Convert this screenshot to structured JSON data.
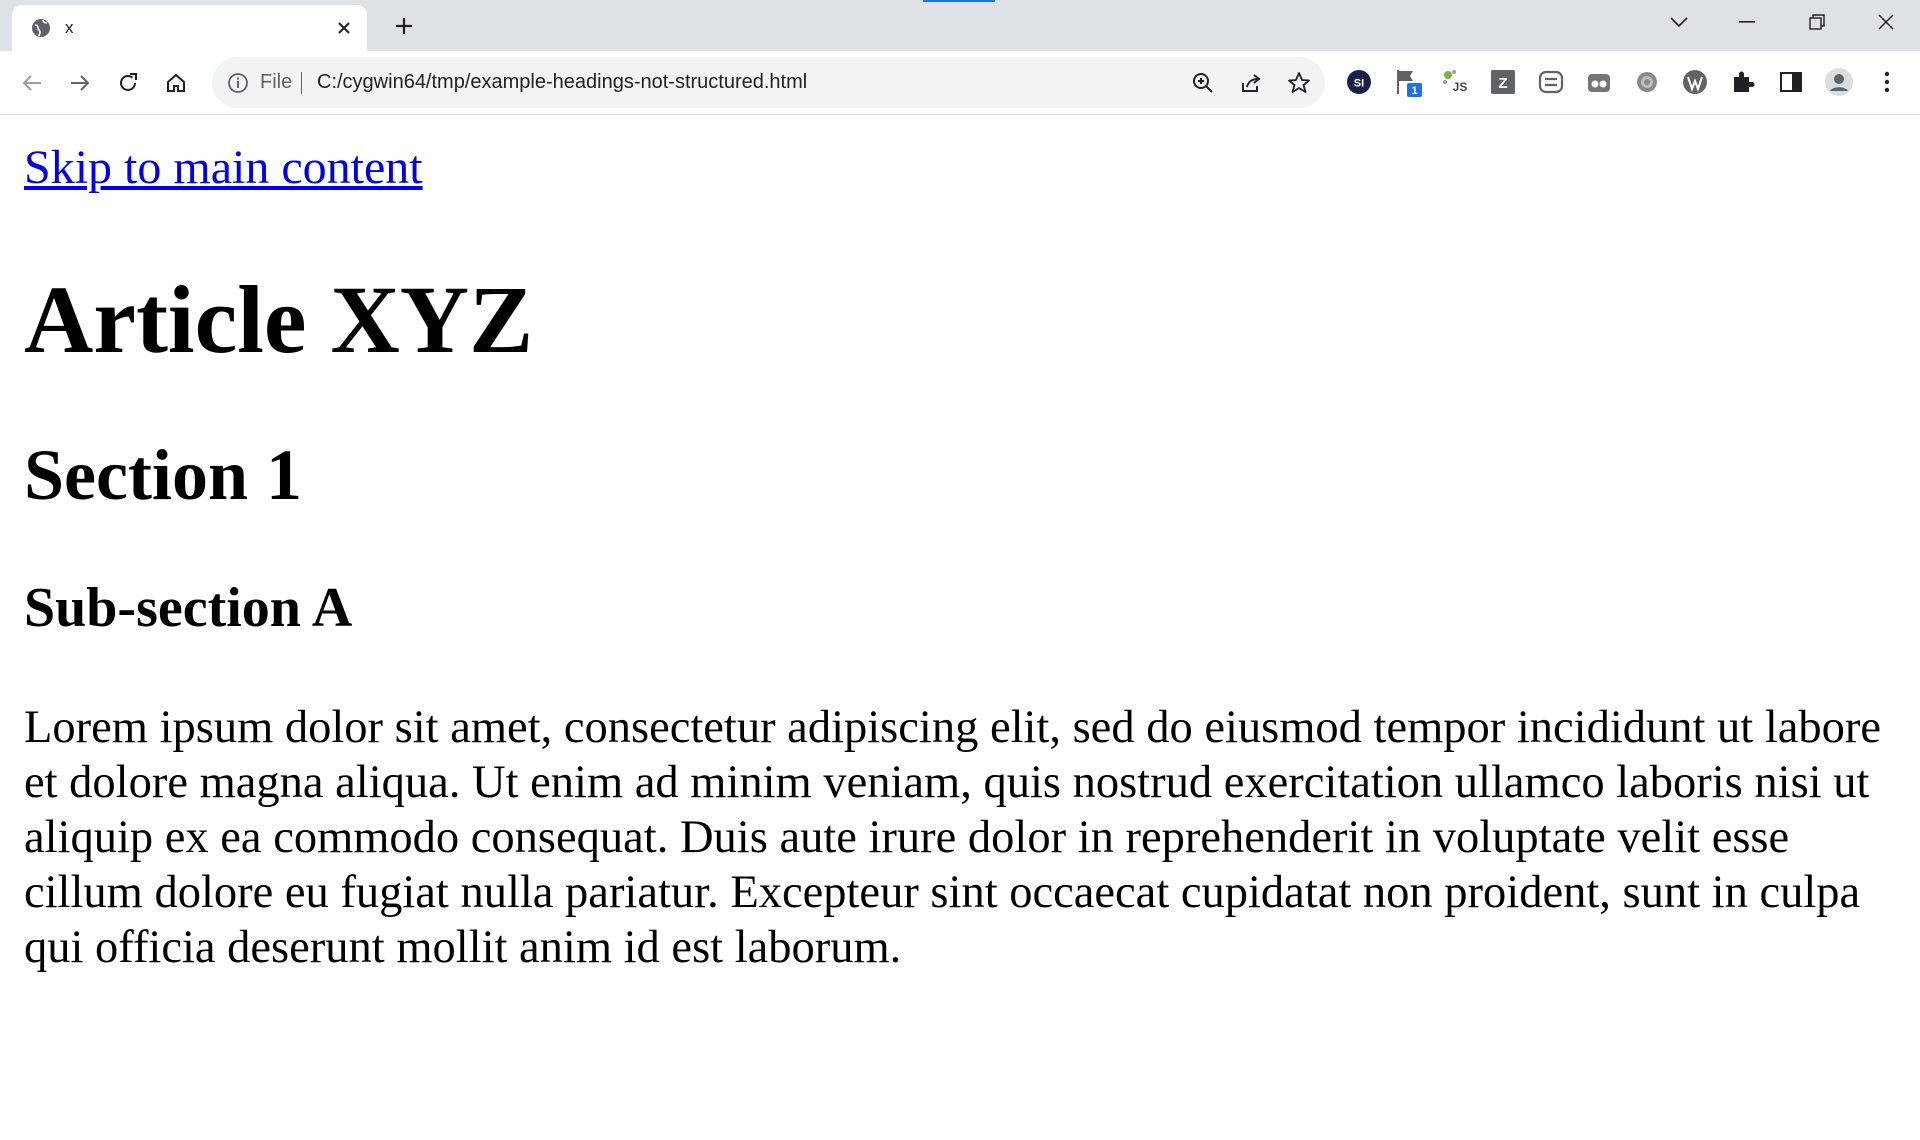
{
  "browser": {
    "tab": {
      "title": "x"
    },
    "address": {
      "scheme": "File",
      "url": "C:/cygwin64/tmp/example-headings-not-structured.html"
    },
    "extensions": [
      {
        "name": "si-extension",
        "label": "SI"
      },
      {
        "name": "flag-extension",
        "badge": "1"
      },
      {
        "name": "js-extension",
        "label": "JS"
      },
      {
        "name": "z-extension",
        "label": "Z"
      }
    ]
  },
  "page": {
    "skip_link": "Skip to main content",
    "heading1": "Article XYZ",
    "heading2": "Section 1",
    "heading3": "Sub-section A",
    "paragraph": "Lorem ipsum dolor sit amet, consectetur adipiscing elit, sed do eiusmod tempor incididunt ut labore et dolore magna aliqua. Ut enim ad minim veniam, quis nostrud exercitation ullamco laboris nisi ut aliquip ex ea commodo consequat. Duis aute irure dolor in reprehenderit in voluptate velit esse cillum dolore eu fugiat nulla pariatur. Excepteur sint occaecat cupidatat non proident, sunt in culpa qui officia deserunt mollit anim id est laborum."
  },
  "colors": {
    "link": "#0000ee",
    "accent": "#1a73e8"
  }
}
